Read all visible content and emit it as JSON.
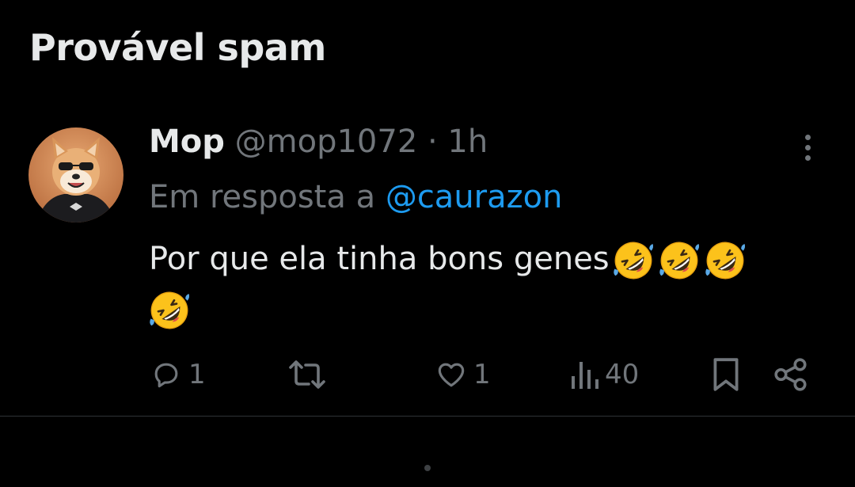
{
  "section": {
    "title": "Provável spam"
  },
  "tweet": {
    "author_name": "Mop",
    "author_handle": "@mop1072",
    "separator": "·",
    "timestamp": "1h",
    "reply_prefix": "Em resposta a ",
    "reply_to": "@caurazon",
    "text": "Por que ela tinha bons genes",
    "emoji_name": "rolling-on-the-floor-laughing-emoji",
    "emoji_count": 4
  },
  "actions": {
    "reply_count": "1",
    "retweet_count": "",
    "like_count": "1",
    "view_count": "40"
  },
  "colors": {
    "background": "#000000",
    "text_primary": "#e7e9ea",
    "text_secondary": "#71767b",
    "accent": "#1d9bf0",
    "divider": "#2f3336"
  }
}
